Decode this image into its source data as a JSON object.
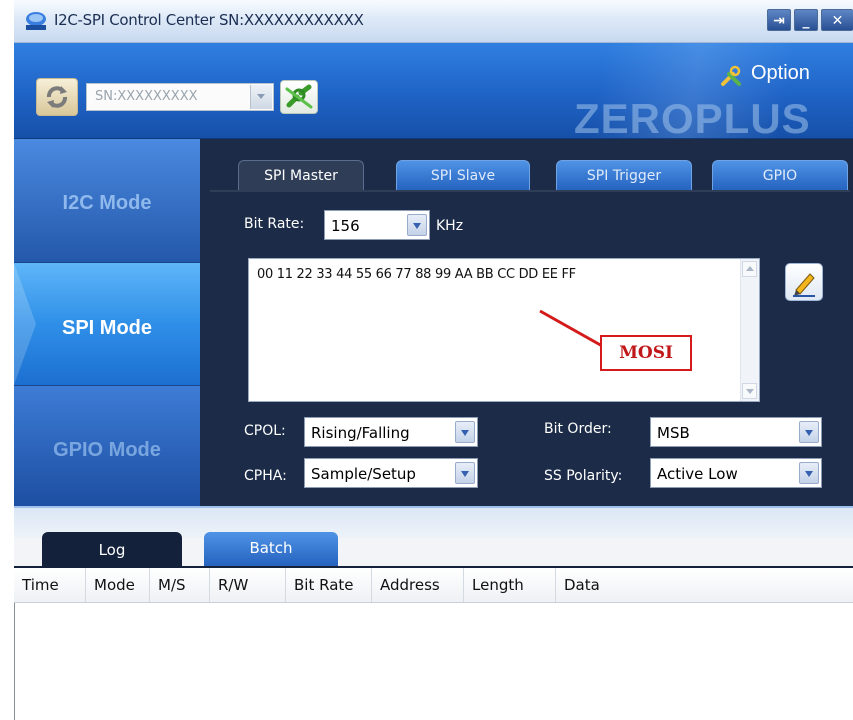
{
  "window": {
    "title": "I2C-SPI Control Center SN:XXXXXXXXXXXX"
  },
  "toolbar": {
    "serial_value": "SN:XXXXXXXXX",
    "option_label": "Option",
    "brand": "ZEROPLUS"
  },
  "sidebar": {
    "items": [
      {
        "label": "I2C Mode"
      },
      {
        "label": "SPI Mode",
        "active": true
      },
      {
        "label": "GPIO Mode"
      }
    ]
  },
  "tabs": [
    {
      "label": "SPI Master",
      "active": true
    },
    {
      "label": "SPI Slave"
    },
    {
      "label": "SPI Trigger"
    },
    {
      "label": "GPIO"
    }
  ],
  "spi": {
    "bit_rate_label": "Bit Rate:",
    "bit_rate_value": "156",
    "bit_rate_unit": "KHz",
    "mosi_data": "00 11 22 33 44 55 66 77 88 99 AA BB CC DD EE FF",
    "mosi_annotation": "MOSI",
    "cpol_label": "CPOL:",
    "cpol_value": "Rising/Falling",
    "cpha_label": "CPHA:",
    "cpha_value": "Sample/Setup",
    "bit_order_label": "Bit Order:",
    "bit_order_value": "MSB",
    "ss_polarity_label": "SS Polarity:",
    "ss_polarity_value": "Active Low"
  },
  "lower_tabs": [
    {
      "label": "Log",
      "active": true
    },
    {
      "label": "Batch"
    }
  ],
  "log_columns": [
    "Time",
    "Mode",
    "M/S",
    "R/W",
    "Bit Rate",
    "Address",
    "Length",
    "Data"
  ],
  "colors": {
    "header_blue": "#1f63c6",
    "panel_dark": "#1c2c48",
    "annotation_red": "#d41a1a"
  }
}
